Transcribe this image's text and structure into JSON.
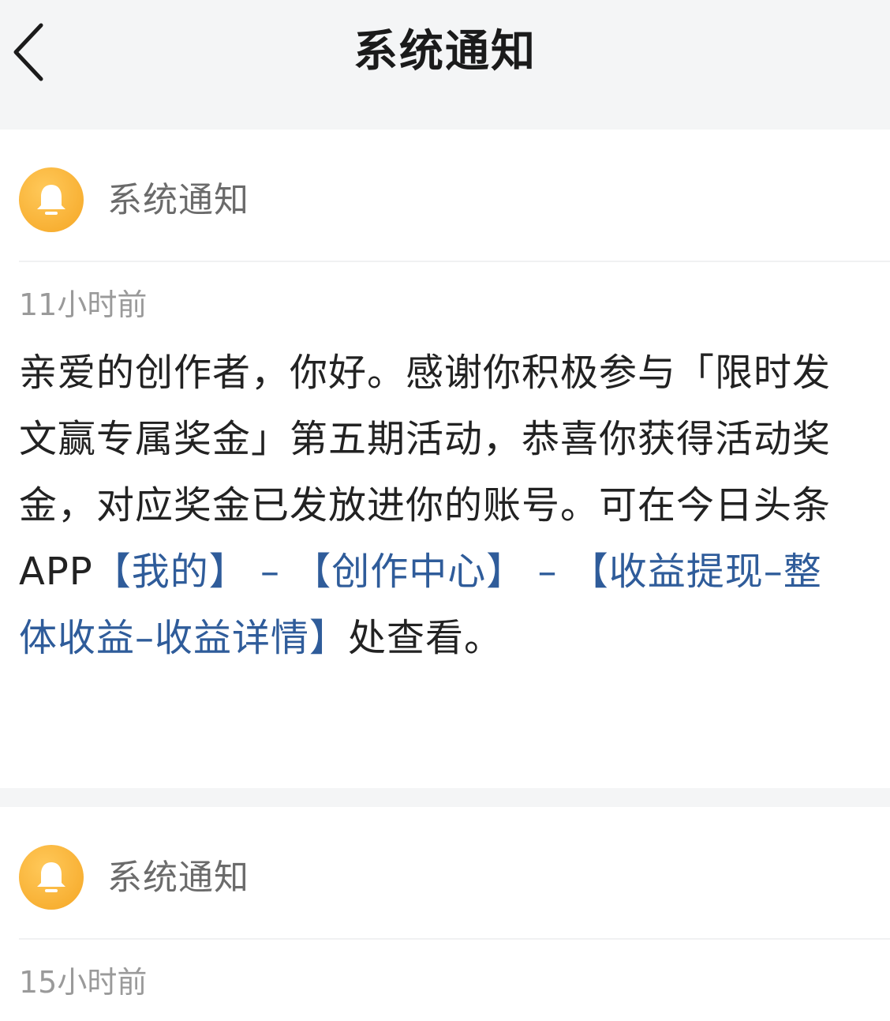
{
  "nav": {
    "title": "系统通知",
    "back_icon": "chevron-left-icon"
  },
  "notifications": [
    {
      "sender": "系统通知",
      "avatar_icon": "bell-icon",
      "avatar_color": "#f9b43a",
      "time": "11小时前",
      "body": {
        "intro": "亲爱的创作者，你好。感谢你积极参与「限时发文赢专属奖金」第五期活动，恭喜你获得活动奖金，对应奖金已发放进你的账号。可在今日头条APP",
        "link_mine": "【我的】",
        "sep1": " – ",
        "link_creator_center": "【创作中心】",
        "sep2": " – ",
        "link_income": "【收益提现–整体收益–收益详情】",
        "outro": "处查看。"
      }
    },
    {
      "sender": "系统通知",
      "avatar_icon": "bell-icon",
      "avatar_color": "#f9b43a",
      "time": "15小时前"
    }
  ],
  "colors": {
    "link": "#2f5c9a",
    "background": "#f4f5f6",
    "card": "#ffffff"
  }
}
